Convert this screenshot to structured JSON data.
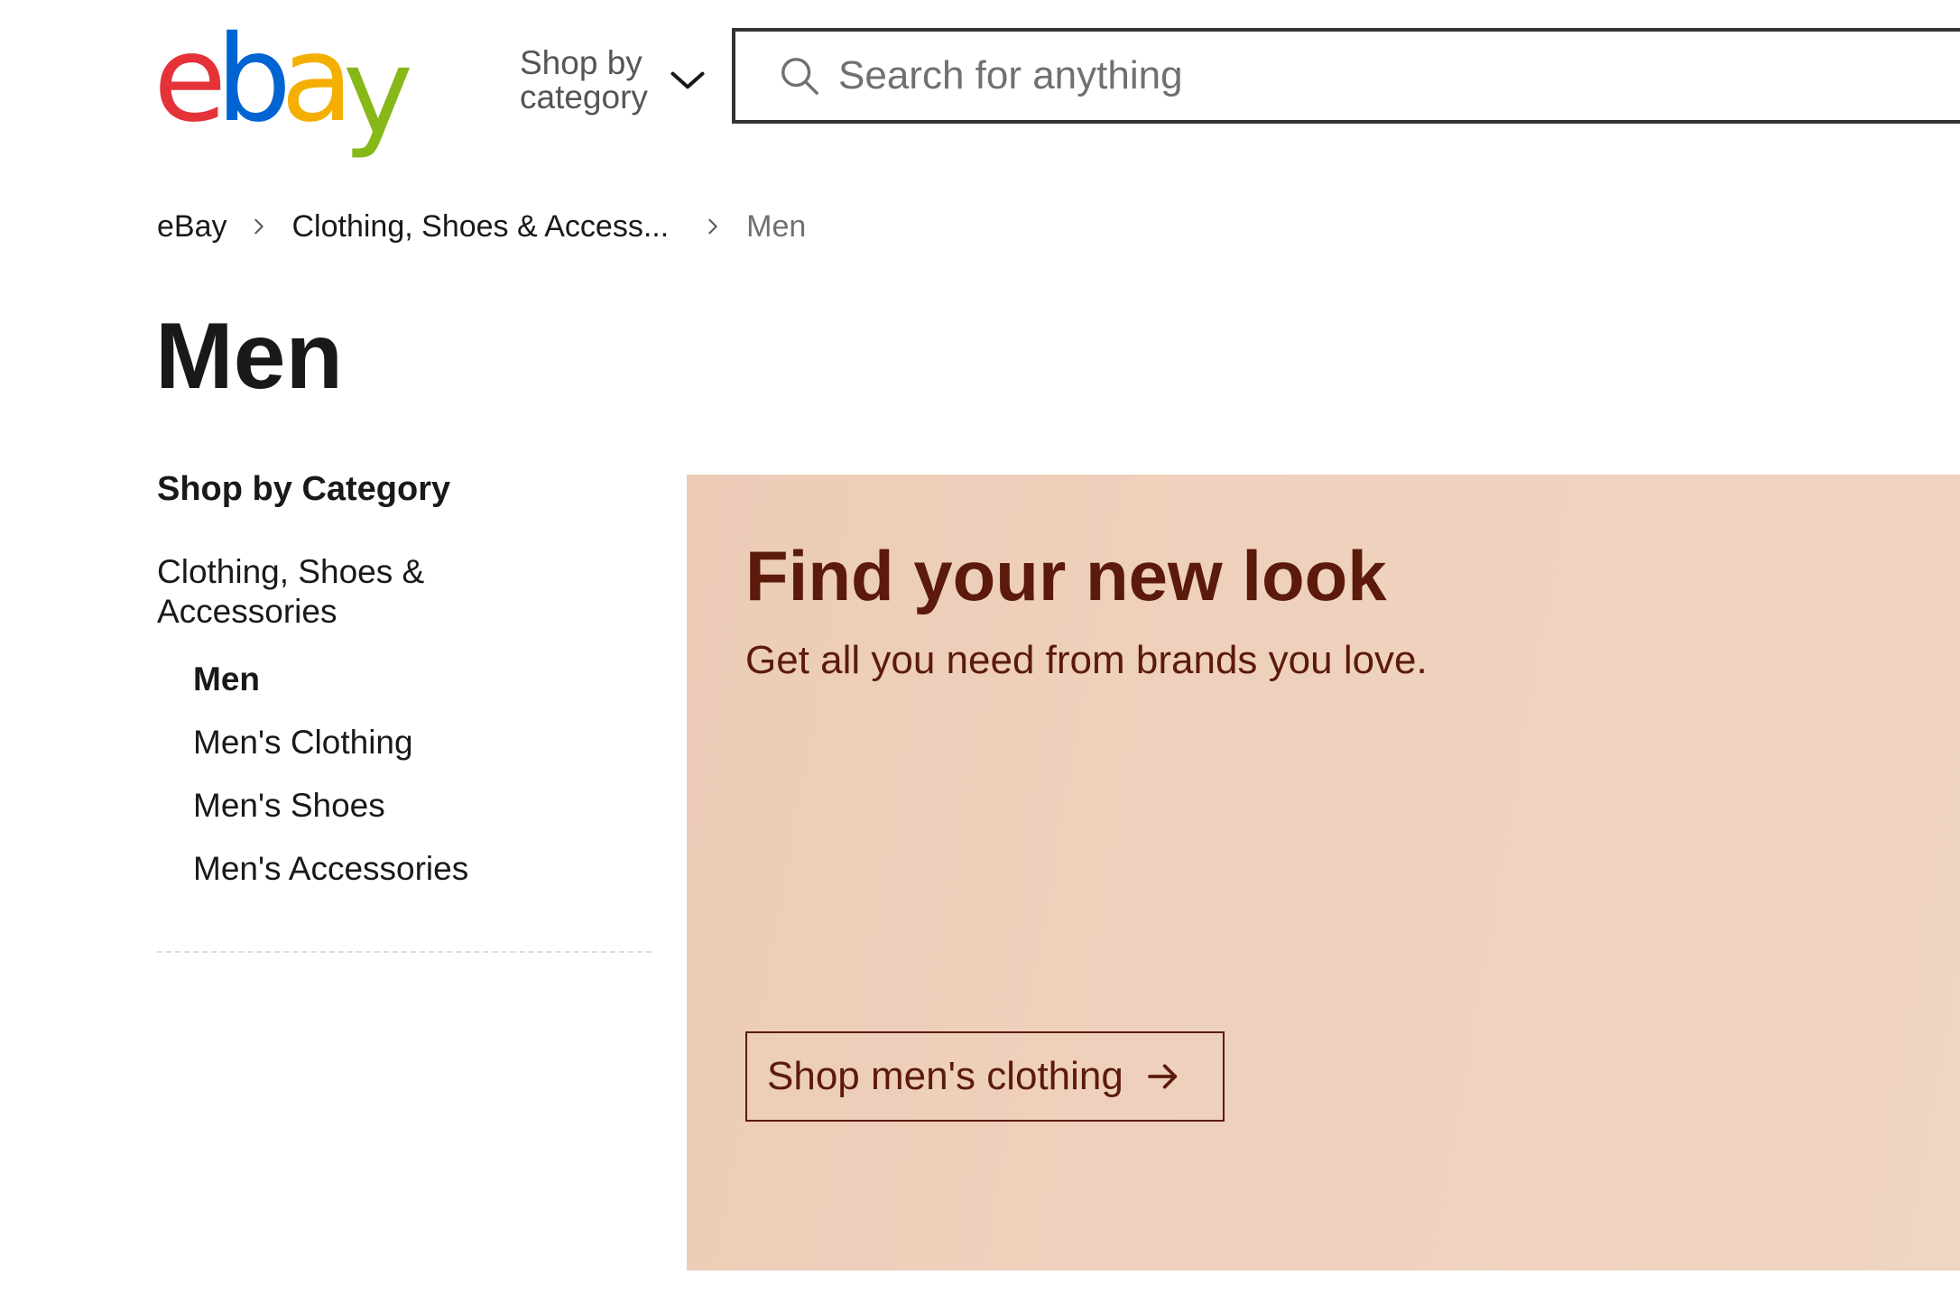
{
  "colors": {
    "logo_e": "#e53238",
    "logo_b": "#0064d2",
    "logo_a": "#f5af02",
    "logo_y": "#86b817",
    "hero_ink": "#5b1a0c",
    "hero_background": "#efd2be"
  },
  "header": {
    "logo": {
      "letters": [
        "e",
        "b",
        "a",
        "y"
      ]
    },
    "shop_by_category": {
      "label": "Shop by category",
      "icon": "chevron-down-icon"
    },
    "search": {
      "placeholder": "Search for anything",
      "value": "",
      "icon": "search-icon"
    }
  },
  "breadcrumb": {
    "items": [
      {
        "label": "eBay"
      },
      {
        "label": "Clothing, Shoes & Access..."
      },
      {
        "label": "Men"
      }
    ],
    "separator_icon": "chevron-right-icon"
  },
  "page": {
    "title": "Men"
  },
  "sidebar": {
    "heading": "Shop by Category",
    "parent": "Clothing, Shoes & Accessories",
    "items": [
      {
        "label": "Men",
        "current": true
      },
      {
        "label": "Men's Clothing"
      },
      {
        "label": "Men's Shoes"
      },
      {
        "label": "Men's Accessories"
      }
    ]
  },
  "hero": {
    "title": "Find your new look",
    "subtitle": "Get all you need from brands you love.",
    "button_label": "Shop men's clothing",
    "button_icon": "arrow-right-icon"
  }
}
